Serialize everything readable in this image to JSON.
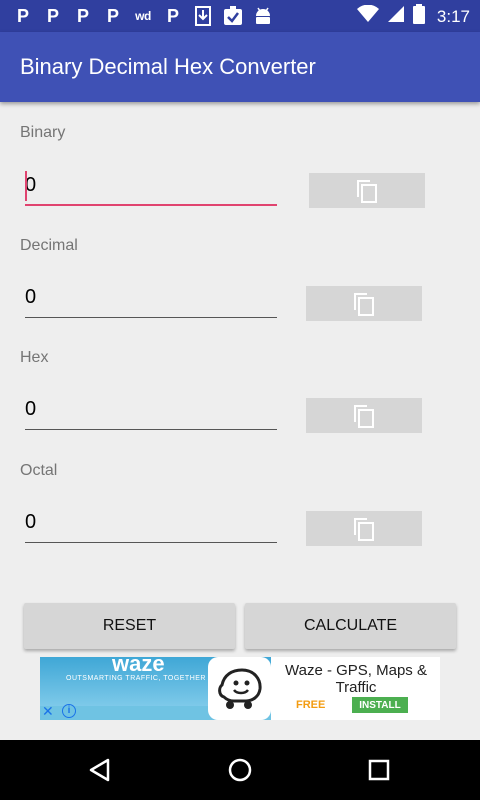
{
  "status_bar": {
    "time": "3:17",
    "notification_icons": [
      "P",
      "P",
      "P",
      "P",
      "wd",
      "P"
    ]
  },
  "app_bar": {
    "title": "Binary Decimal Hex Converter"
  },
  "fields": [
    {
      "label": "Binary",
      "value": "0"
    },
    {
      "label": "Decimal",
      "value": "0"
    },
    {
      "label": "Hex",
      "value": "0"
    },
    {
      "label": "Octal",
      "value": "0"
    }
  ],
  "buttons": {
    "reset": "RESET",
    "calculate": "CALCULATE"
  },
  "ad": {
    "brand": "waze",
    "tagline": "OUTSMARTING TRAFFIC, TOGETHER",
    "title": "Waze - GPS, Maps & Traffic",
    "price": "FREE",
    "install": "INSTALL"
  },
  "colors": {
    "status_bar": "#303f9f",
    "app_bar": "#3f51b5",
    "accent": "#e0436f",
    "install": "#4caf50",
    "free": "#f39c12"
  }
}
